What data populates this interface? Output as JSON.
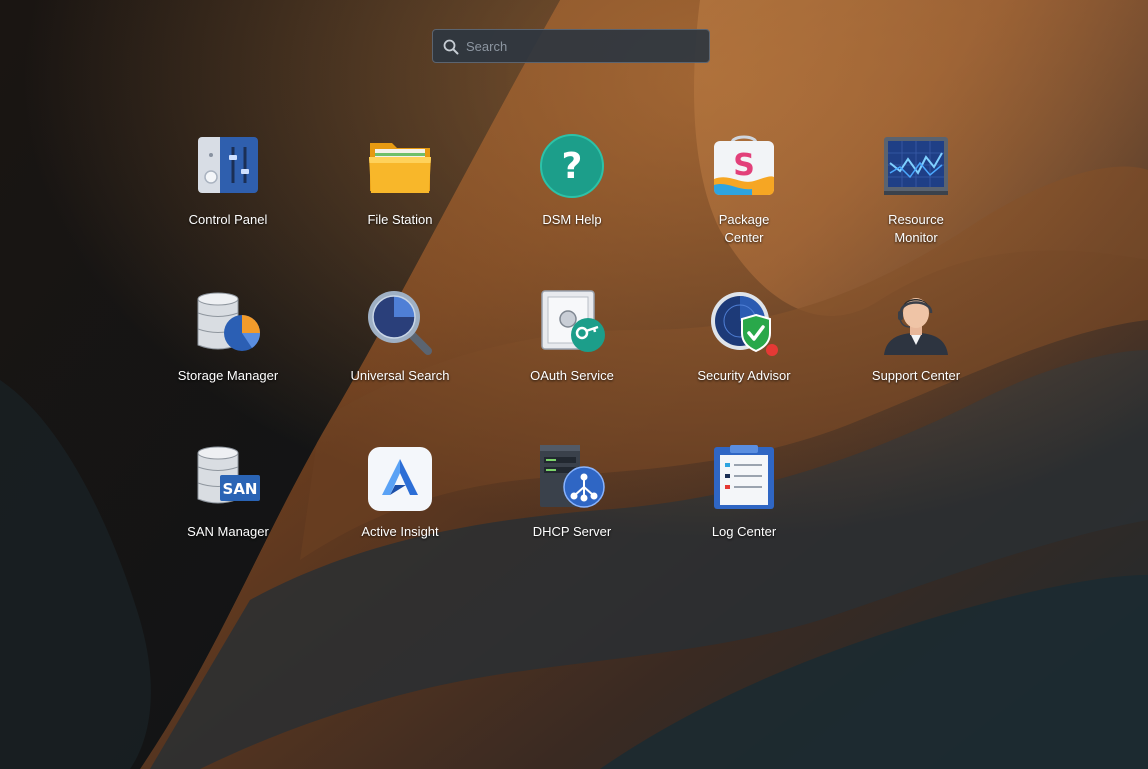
{
  "search": {
    "placeholder": "Search",
    "icon": "search-icon"
  },
  "apps": [
    {
      "name": "control-panel",
      "line1": "Control Panel",
      "line2": "",
      "icon": "control-panel-icon"
    },
    {
      "name": "file-station",
      "line1": "File Station",
      "line2": "",
      "icon": "folder-icon"
    },
    {
      "name": "dsm-help",
      "line1": "DSM Help",
      "line2": "",
      "icon": "help-icon"
    },
    {
      "name": "package-center",
      "line1": "Package",
      "line2": "Center",
      "icon": "package-bag-icon"
    },
    {
      "name": "resource-monitor",
      "line1": "Resource",
      "line2": "Monitor",
      "icon": "monitor-graph-icon"
    },
    {
      "name": "storage-manager",
      "line1": "Storage Manager",
      "line2": "",
      "icon": "database-pie-icon"
    },
    {
      "name": "universal-search",
      "line1": "Universal Search",
      "line2": "",
      "icon": "magnifier-icon"
    },
    {
      "name": "oauth-service",
      "line1": "OAuth Service",
      "line2": "",
      "icon": "safe-key-icon"
    },
    {
      "name": "security-advisor",
      "line1": "Security Advisor",
      "line2": "",
      "icon": "radar-shield-icon",
      "badge": "notification-dot"
    },
    {
      "name": "support-center",
      "line1": "Support Center",
      "line2": "",
      "icon": "support-agent-icon"
    },
    {
      "name": "san-manager",
      "line1": "SAN Manager",
      "line2": "",
      "icon": "database-san-icon",
      "badge_text": "SAN"
    },
    {
      "name": "active-insight",
      "line1": "Active Insight",
      "line2": "",
      "icon": "active-insight-logo-icon"
    },
    {
      "name": "dhcp-server",
      "line1": "DHCP Server",
      "line2": "",
      "icon": "server-network-icon"
    },
    {
      "name": "log-center",
      "line1": "Log Center",
      "line2": "",
      "icon": "clipboard-log-icon"
    }
  ],
  "colors": {
    "search_bg": "#2e3640",
    "search_border": "#5b6470",
    "label": "#ffffff",
    "badge_red": "#e53935"
  }
}
